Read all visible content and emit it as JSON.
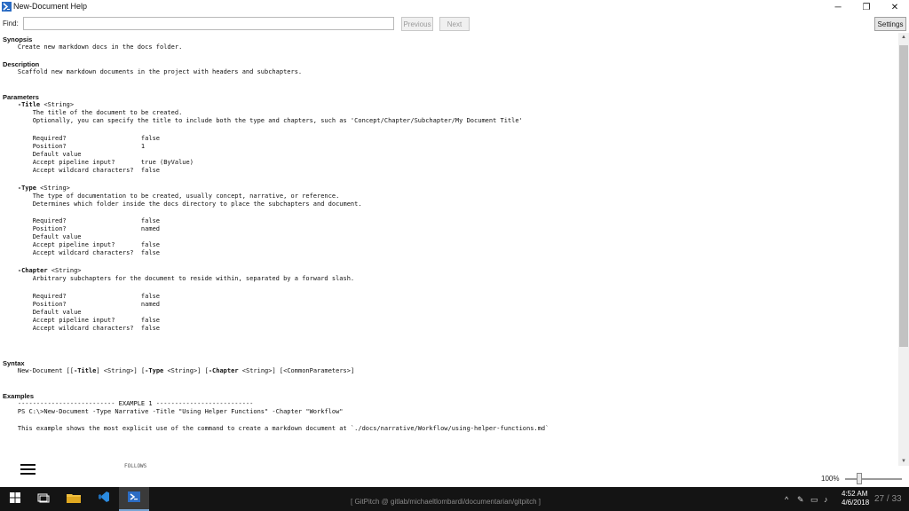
{
  "window": {
    "title": "New-Document Help",
    "minimize_glyph": "─",
    "maximize_glyph": "❐",
    "close_glyph": "✕"
  },
  "find": {
    "label": "Find:",
    "value": "",
    "previous_label": "Previous",
    "next_label": "Next",
    "settings_label": "Settings"
  },
  "help": {
    "synopsis_heading": "Synopsis",
    "synopsis_text": "    Create new markdown docs in the docs folder.",
    "description_heading": "Description",
    "description_text": "    Scaffold new markdown documents in the project with headers and subchapters.",
    "parameters_heading": "Parameters",
    "params": [
      {
        "name": "-Title",
        "type": " <String>",
        "desc": [
          "        The title of the document to be created.",
          "        Optionally, you can specify the title to include both the type and chapters, such as 'Concept/Chapter/Subchapter/My Document Title'"
        ],
        "props": [
          "        Required?                    false",
          "        Position?                    1",
          "        Default value",
          "        Accept pipeline input?       true (ByValue)",
          "        Accept wildcard characters?  false"
        ]
      },
      {
        "name": "-Type",
        "type": " <String>",
        "desc": [
          "        The type of documentation to be created, usually concept, narrative, or reference.",
          "        Determines which folder inside the docs directory to place the subchapters and document."
        ],
        "props": [
          "        Required?                    false",
          "        Position?                    named",
          "        Default value",
          "        Accept pipeline input?       false",
          "        Accept wildcard characters?  false"
        ]
      },
      {
        "name": "-Chapter",
        "type": " <String>",
        "desc": [
          "        Arbitrary subchapters for the document to reside within, separated by a forward slash."
        ],
        "props": [
          "        Required?                    false",
          "        Position?                    named",
          "        Default value",
          "        Accept pipeline input?       false",
          "        Accept wildcard characters?  false"
        ]
      }
    ],
    "syntax_heading": "Syntax",
    "syntax_parts": [
      "    New-Document [[",
      "-Title",
      "] <String>] [",
      "-Type",
      " <String>] [",
      "-Chapter",
      " <String>] [<CommonParameters>]"
    ],
    "examples_heading": "Examples",
    "example_banner": "    -------------------------- EXAMPLE 1 --------------------------",
    "example_cmd": "    PS C:\\>New-Document -Type Narrative -Title \"Using Helper Functions\" -Chapter \"Workflow\"",
    "example_note": "    This example shows the most explicit use of the command to create a markdown document at `./docs/narrative/Workflow/using-helper-functions.md`",
    "partial_line": "FOLLOWS"
  },
  "zoom": {
    "label": "100%",
    "level_percent": 100
  },
  "taskbar": {
    "caption": "[ GitPitch @ gitlab/michaeltlombardi/documentarian/gitpitch ]",
    "time": "4:52 AM",
    "date": "4/6/2018",
    "overlay_number": "27 / 33"
  },
  "colors": {
    "taskbar_bg": "#141414",
    "accent": "#2b6cc4",
    "disabled_text": "#9a9a9a"
  }
}
